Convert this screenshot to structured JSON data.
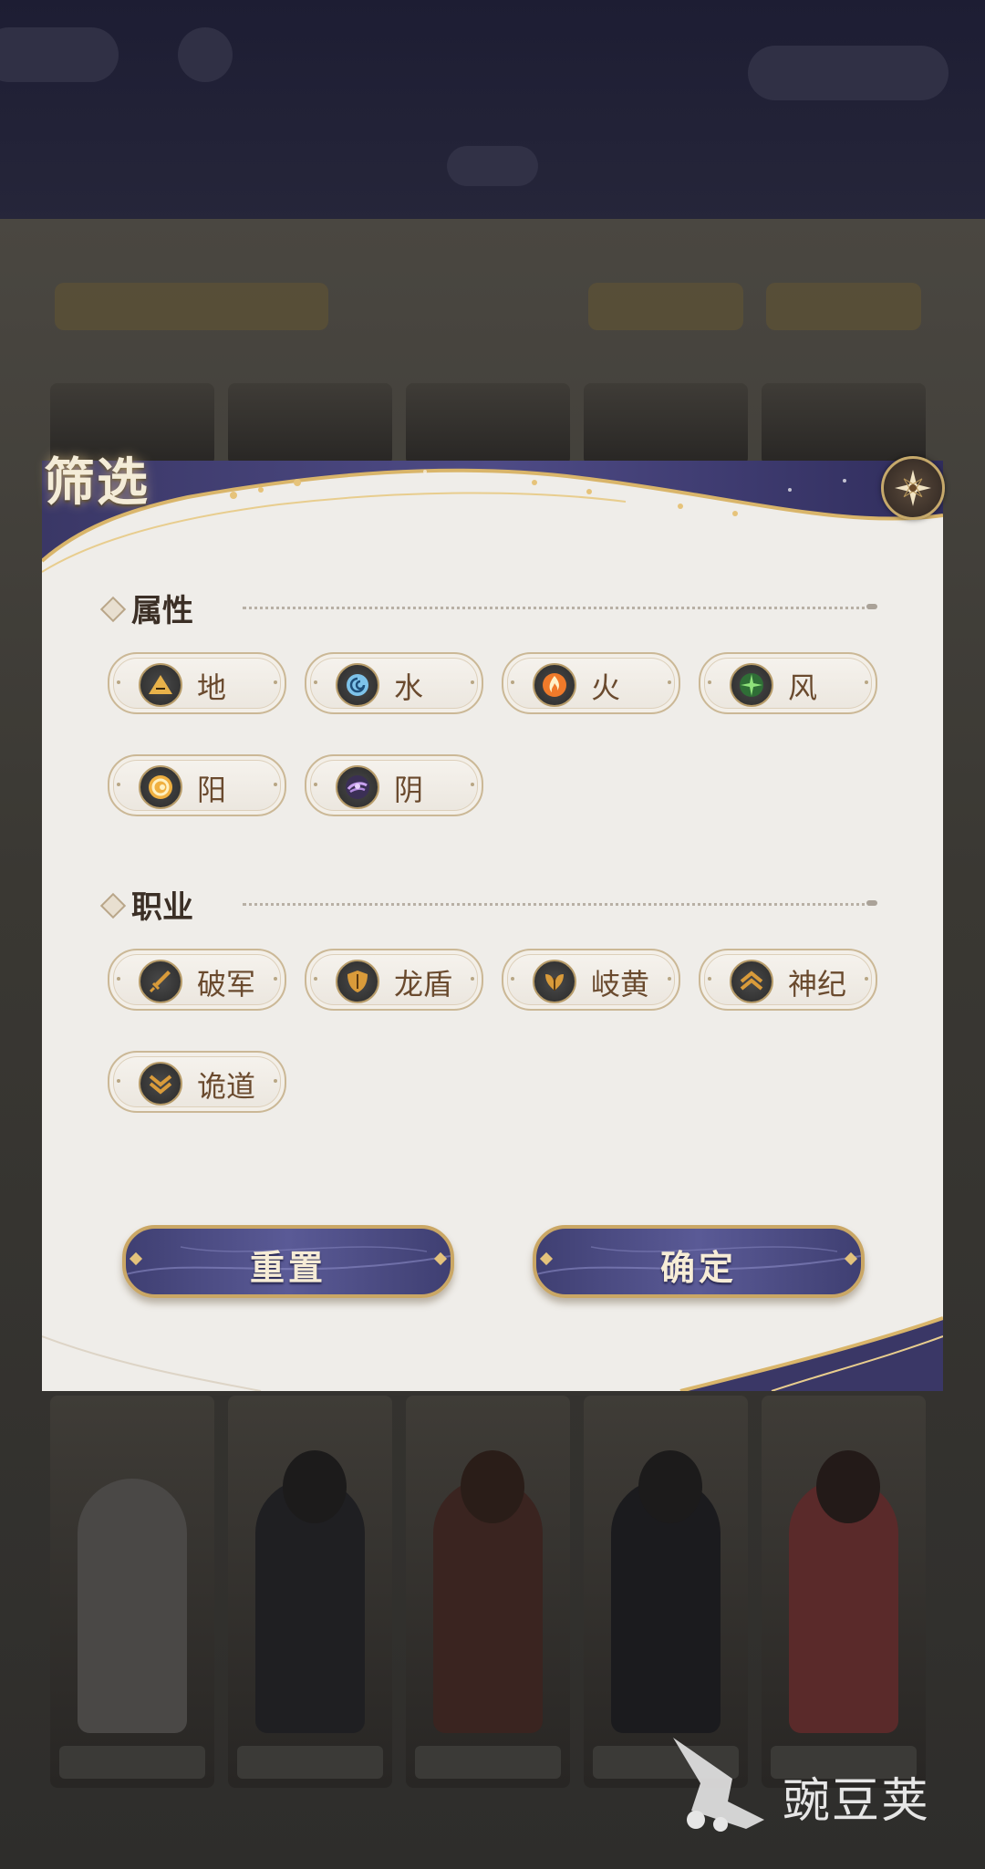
{
  "dialog": {
    "title": "筛选",
    "sections": [
      {
        "title": "属性",
        "options": [
          {
            "label": "地",
            "icon": "earth-icon",
            "color": "#e8b24a"
          },
          {
            "label": "水",
            "icon": "water-icon",
            "color": "#7ec3ea"
          },
          {
            "label": "火",
            "icon": "fire-icon",
            "color": "#f07a2a"
          },
          {
            "label": "风",
            "icon": "wind-icon",
            "color": "#6ecf5a"
          },
          {
            "label": "阳",
            "icon": "sun-icon",
            "color": "#f0b040"
          },
          {
            "label": "阴",
            "icon": "moon-icon",
            "color": "#b48ce0"
          }
        ]
      },
      {
        "title": "职业",
        "options": [
          {
            "label": "破军",
            "icon": "sword-icon",
            "color": "#d99b3a"
          },
          {
            "label": "龙盾",
            "icon": "shield-icon",
            "color": "#d99b3a"
          },
          {
            "label": "岐黄",
            "icon": "herb-icon",
            "color": "#d99b3a"
          },
          {
            "label": "神纪",
            "icon": "chevron-up-icon",
            "color": "#d99b3a"
          },
          {
            "label": "诡道",
            "icon": "chevron-down-double-icon",
            "color": "#d99b3a"
          }
        ]
      }
    ],
    "buttons": {
      "reset": "重置",
      "confirm": "确定"
    }
  },
  "watermark": {
    "text": "豌豆荚"
  },
  "colors": {
    "accent_gold": "#caa765",
    "button_purple": "#4a4a82",
    "dialog_bg": "#efede9"
  }
}
